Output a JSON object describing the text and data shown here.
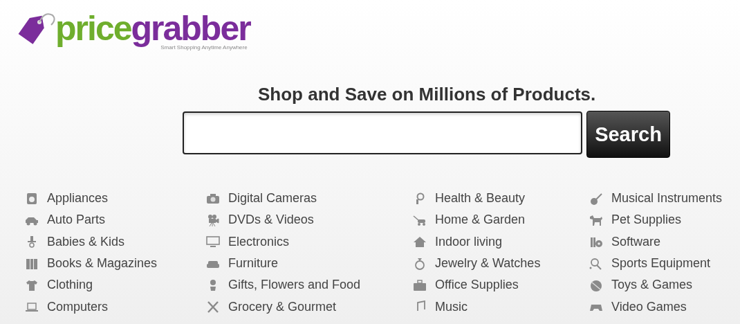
{
  "logo": {
    "word_start": "price",
    "word_end": "grabber",
    "tagline": "Smart Shopping Anytime Anywhere"
  },
  "headline": "Shop and Save on Millions of Products.",
  "search": {
    "button": "Search"
  },
  "category_columns": [
    {
      "items": [
        "Appliances",
        "Auto Parts",
        "Babies & Kids",
        "Books & Magazines",
        "Clothing",
        "Computers"
      ]
    },
    {
      "items": [
        "Digital Cameras",
        "DVDs & Videos",
        "Electronics",
        "Furniture",
        "Gifts, Flowers and Food",
        "Grocery & Gourmet"
      ]
    },
    {
      "items": [
        "Health & Beauty",
        "Home & Garden",
        "Indoor living",
        "Jewelry & Watches",
        "Office Supplies",
        "Music"
      ]
    },
    {
      "items": [
        "Musical Instruments",
        "Pet Supplies",
        "Software",
        "Sports Equipment",
        "Toys & Games",
        "Video Games"
      ]
    }
  ]
}
